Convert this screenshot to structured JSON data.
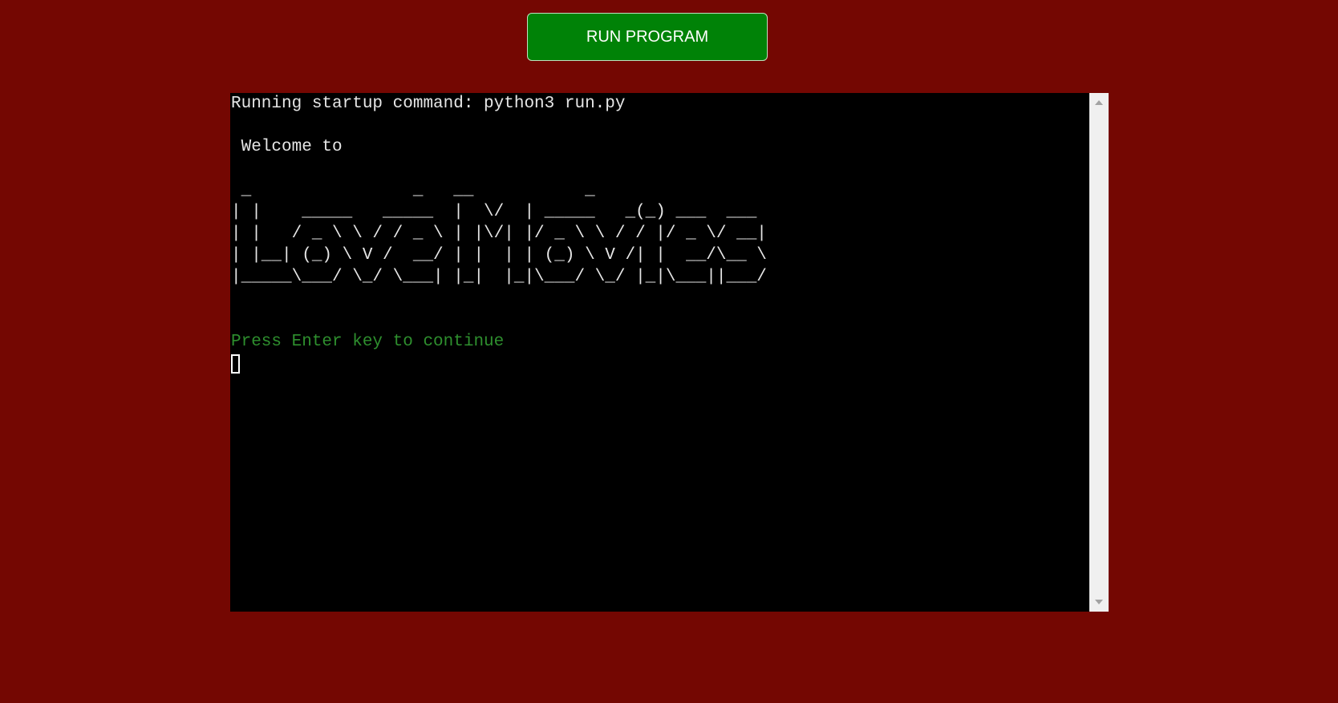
{
  "run_button": {
    "label": "RUN PROGRAM"
  },
  "terminal": {
    "lines": [
      "Running startup command: python3 run.py",
      "",
      " Welcome to",
      "",
      " _                _   __           _",
      "| |    _____   _____  |  \\/  | _____   _(_) ___  ___",
      "| |   / _ \\ \\ / / _ \\ | |\\/| |/ _ \\ \\ / / |/ _ \\/ __|",
      "| |__| (_) \\ V /  __/ | |  | | (_) \\ V /| |  __/\\__ \\",
      "|_____\\___/ \\_/ \\___| |_|  |_|\\___/ \\_/ |_|\\___||___/",
      "",
      "",
      "Press Enter key to continue"
    ]
  },
  "colors": {
    "background": "#740702",
    "button": "#008207",
    "terminal_bg": "#000000",
    "terminal_text": "#e6e6e6",
    "prompt_text": "#2e8f2e"
  },
  "icons": {
    "scroll_up": "triangle-up-icon",
    "scroll_down": "triangle-down-icon"
  }
}
